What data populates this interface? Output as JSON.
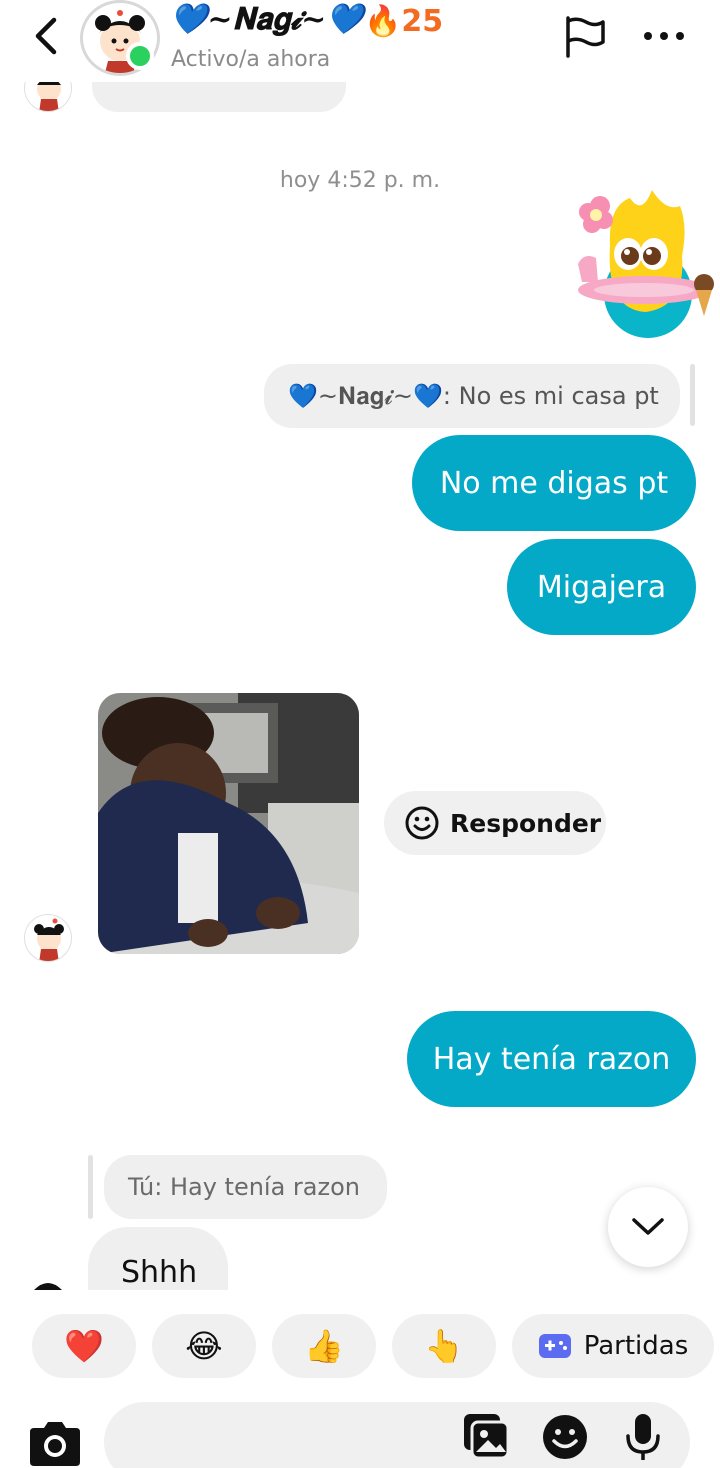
{
  "header": {
    "contact_name": "💙~𝐍𝐚𝐠𝓲~💙",
    "streak_icon": "fire-icon",
    "streak_count": "🔥25",
    "status": "Activo/a ahora"
  },
  "messages": {
    "timestamp": "hoy 4:52 p. m.",
    "quoted_reply_out": "💙~𝐍𝐚𝐠𝓲~💙: No es mi casa pt",
    "out_1": "No me digas pt",
    "out_2": "Migajera",
    "responder_label": "Responder",
    "out_3": "Hay tenía razon",
    "quoted_reply_in": "Tú: Hay tenía razon",
    "in_1": "Shhh"
  },
  "reactions": {
    "heart": "❤️",
    "laugh": "😂",
    "thumbs_up": "👍",
    "pointing": "👆",
    "games_label": "Partidas"
  },
  "colors": {
    "outgoing_bubble": "#04a9c7",
    "incoming_bubble": "#efefef",
    "online": "#2bd15f",
    "streak": "#f26b21"
  }
}
